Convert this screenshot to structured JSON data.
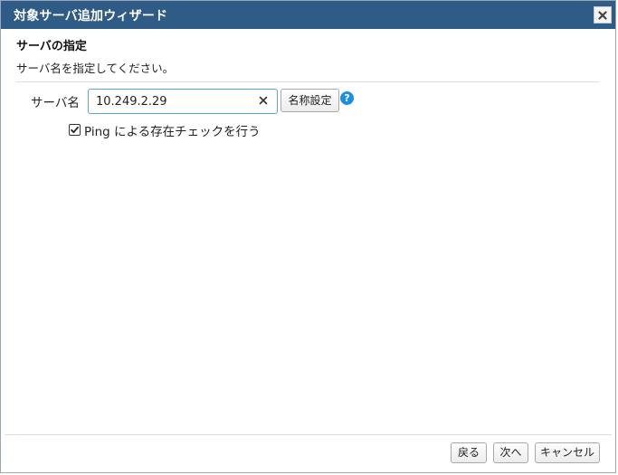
{
  "window": {
    "title": "対象サーバ追加ウィザード"
  },
  "section": {
    "title": "サーバの指定",
    "description": "サーバ名を指定してください。"
  },
  "server_field": {
    "label": "サーバ名",
    "value": "10.249.2.29",
    "name_button_label": "名称設定",
    "help_icon_text": "?"
  },
  "ping_check": {
    "label": "Ping による存在チェックを行う",
    "checked": true
  },
  "footer": {
    "back_label": "戻る",
    "next_label": "次へ",
    "cancel_label": "キャンセル"
  },
  "colors": {
    "titlebar": "#2f5c86",
    "input_focus_border": "#5ba4d6",
    "help_icon": "#1e8fe0"
  }
}
